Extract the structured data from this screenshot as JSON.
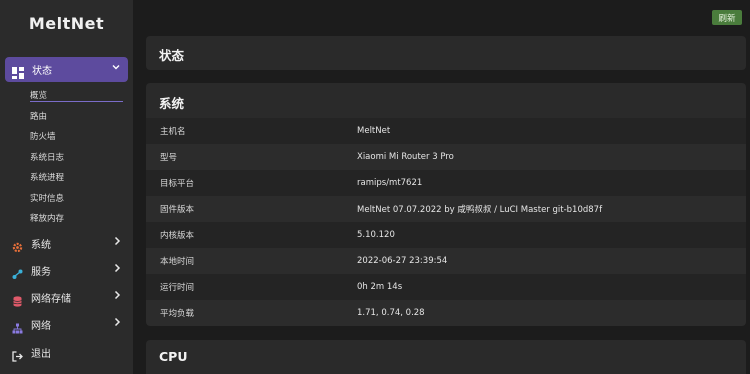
{
  "sidebar": {
    "logo": "MeltNet",
    "status": {
      "label": "状态"
    },
    "status_sub": [
      "概览",
      "路由",
      "防火墙",
      "系统日志",
      "系统进程",
      "实时信息",
      "释放内存"
    ],
    "items": [
      {
        "label": "系统",
        "icon": "gear-icon"
      },
      {
        "label": "服务",
        "icon": "share-icon"
      },
      {
        "label": "网络存储",
        "icon": "database-icon"
      },
      {
        "label": "网络",
        "icon": "network-icon"
      }
    ],
    "logout": "退出"
  },
  "header": {
    "refresh_label": "刷新"
  },
  "page_title": "状态",
  "system_card": {
    "title": "系统",
    "rows": [
      {
        "key": "主机名",
        "value": "MeltNet"
      },
      {
        "key": "型号",
        "value": "Xiaomi Mi Router 3 Pro"
      },
      {
        "key": "目标平台",
        "value": "ramips/mt7621"
      },
      {
        "key": "固件版本",
        "value": "MeltNet 07.07.2022 by 咸鸭叔叔 / LuCI Master git-b10d87f"
      },
      {
        "key": "内核版本",
        "value": "5.10.120"
      },
      {
        "key": "本地时间",
        "value": "2022-06-27 23:39:54"
      },
      {
        "key": "运行时间",
        "value": "0h 2m 14s"
      },
      {
        "key": "平均负载",
        "value": "1.71, 0.74, 0.28"
      }
    ]
  },
  "cpu_card": {
    "title": "CPU"
  },
  "colors": {
    "accent": "#5d4b9e",
    "refresh": "#4a7c3c"
  }
}
